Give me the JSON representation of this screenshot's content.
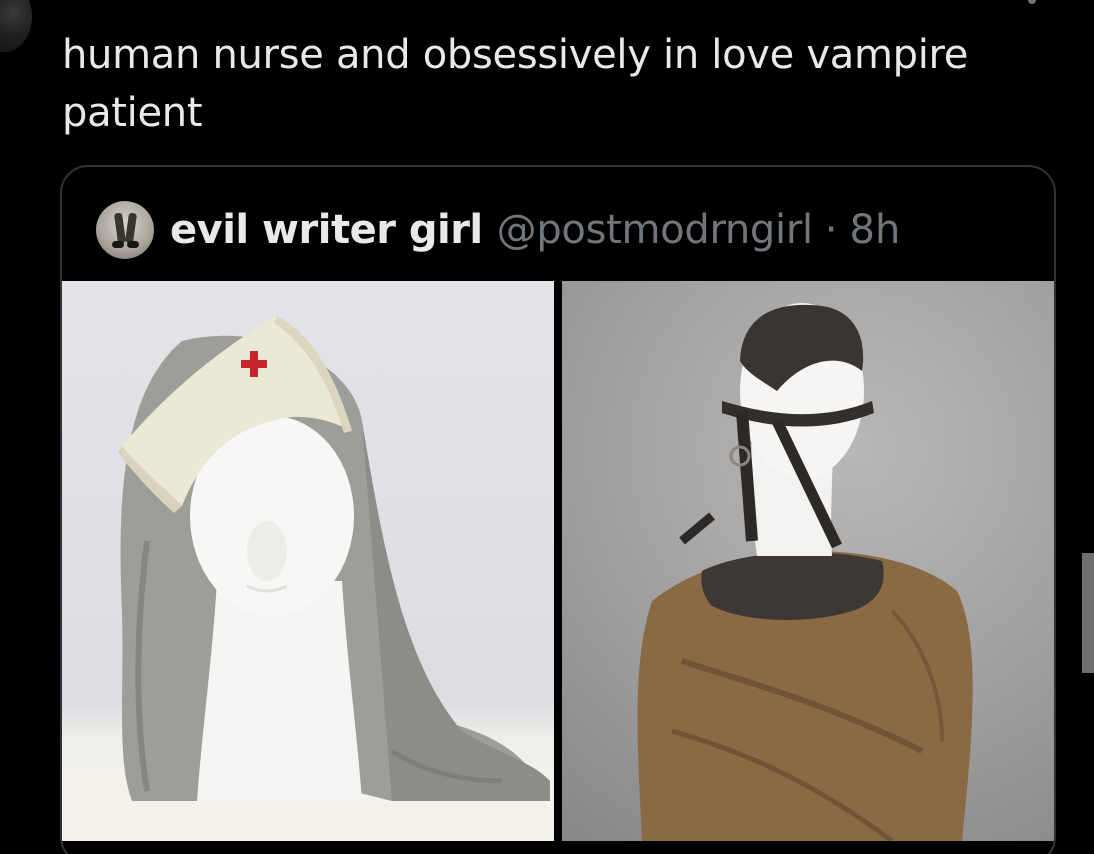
{
  "tweet": {
    "text": "human nurse and obsessively in love vampire patient"
  },
  "quote": {
    "display_name": "evil writer girl",
    "handle": "@postmodrngirl",
    "separator": "·",
    "time": "8h"
  },
  "media": [
    {
      "subject": "mannequin head wearing white nurse cap with red cross and grey veil"
    },
    {
      "subject": "mannequin wearing leather restraint mask and brown straitjacket"
    }
  ],
  "colors": {
    "background": "#000000",
    "text_primary": "#e7e9ea",
    "text_secondary": "#71767b",
    "border": "#2f3336",
    "red_cross": "#c8242c"
  }
}
